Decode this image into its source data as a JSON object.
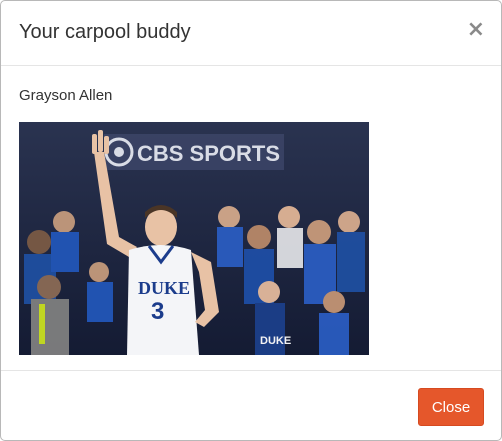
{
  "modal": {
    "title": "Your carpool buddy",
    "close_icon": "close-icon",
    "close_glyph": "×"
  },
  "body": {
    "buddy_name": "Grayson Allen",
    "photo": {
      "jersey_team": "DUKE",
      "jersey_number": "3",
      "banner_text": "CBS SPORTS",
      "fan_shirt_text": "DUKE"
    }
  },
  "footer": {
    "close_label": "Close"
  },
  "colors": {
    "accent": "#e5572b",
    "title_text": "#333333",
    "divider": "#e5e5e5"
  }
}
